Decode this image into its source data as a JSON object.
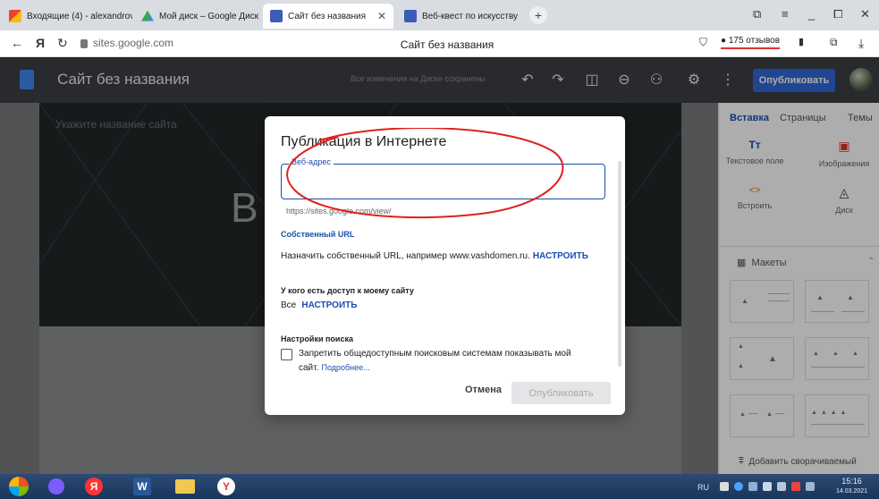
{
  "browser": {
    "tabs": [
      {
        "title": "Входящие (4) - alexandrov",
        "icon": "gmail-icon"
      },
      {
        "title": "Мой диск – Google Диск",
        "icon": "google-drive-icon"
      },
      {
        "title": "Сайт без названия",
        "icon": "google-sites-icon",
        "active": true
      },
      {
        "title": "Веб-квест по искусству",
        "icon": "google-sites-icon"
      }
    ],
    "new_tab": "+",
    "url": "sites.google.com",
    "page_title": "Сайт без названия",
    "reviews": "175 отзывов"
  },
  "header": {
    "site_title": "Сайт без названия",
    "saved_status": "Все изменения на Диске сохранены",
    "publish_label": "Опубликовать"
  },
  "canvas": {
    "hero_placeholder": "Укажите название сайта",
    "hero_big_letter": "В"
  },
  "panel": {
    "tabs": [
      "Вставка",
      "Страницы",
      "Темы"
    ],
    "items": [
      {
        "label": "Текстовое поле",
        "icon": "text-box-icon",
        "glyph": "Tт"
      },
      {
        "label": "Изображения",
        "icon": "image-icon",
        "glyph": "▣"
      },
      {
        "label": "Встроить",
        "icon": "embed-icon",
        "glyph": "<>"
      },
      {
        "label": "Диск",
        "icon": "drive-icon",
        "glyph": "◬"
      }
    ],
    "layouts_label": "Макеты",
    "add_collapsible": "Добавить сворачиваемый"
  },
  "modal": {
    "title": "Публикация в Интернете",
    "url_label": "Веб-адрес",
    "url_value": "",
    "url_hint": "https://sites.google.com/view/",
    "custom_url_title": "Собственный URL",
    "custom_url_text": "Назначить собственный URL, например www.vashdomen.ru.",
    "custom_url_link": "НАСТРОИТЬ",
    "access_title": "У кого есть доступ к моему сайту",
    "access_value": "Все",
    "access_link": "НАСТРОИТЬ",
    "search_title": "Настройки поиска",
    "search_checkbox_text_1": "Запретить общедоступным поисковым системам показывать мой",
    "search_checkbox_text_2": "сайт.",
    "search_more_link": "Подробнее...",
    "search_checked": false,
    "cancel_label": "Отмена",
    "publish_label": "Опубликовать"
  },
  "taskbar": {
    "lang": "RU",
    "time": "15:16",
    "date": "14.03.2021"
  },
  "colors": {
    "accent": "#1a4fb0",
    "publish": "#3267d6",
    "header_bg": "#3c3f44",
    "annotation": "#e02020"
  }
}
